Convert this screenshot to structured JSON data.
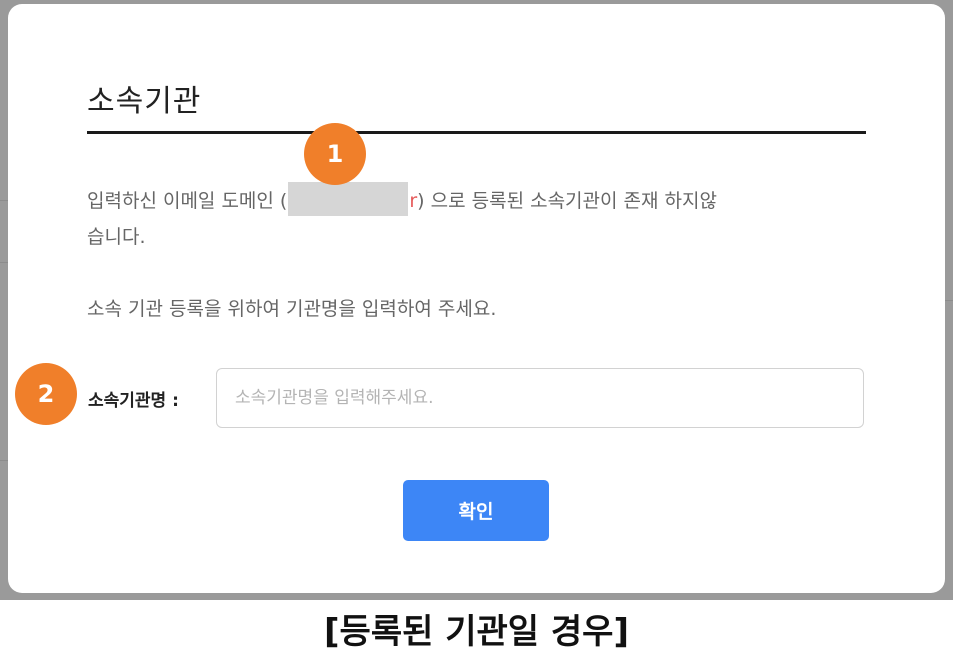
{
  "dialog": {
    "title": "소속기관",
    "message_line1_before": "입력하신 이메일 도메인 (",
    "message_line1_char": "r",
    "message_line1_after": ") 으로 등록된 소속기관이 존재 하지않",
    "message_line2": "습니다.",
    "message_line3": "소속 기관 등록을 위하여 기관명을 입력하여 주세요.",
    "field_label": "소속기관명 :",
    "field_placeholder": "소속기관명을 입력해주세요.",
    "field_value": "",
    "confirm_label": "확인"
  },
  "annotations": {
    "badge1": "1",
    "badge2": "2",
    "badge_color": "#f07f2a"
  },
  "caption": "[등록된 기관일 경우]",
  "colors": {
    "accent": "#3d86f6",
    "domain_highlight": "#e55b5b"
  }
}
